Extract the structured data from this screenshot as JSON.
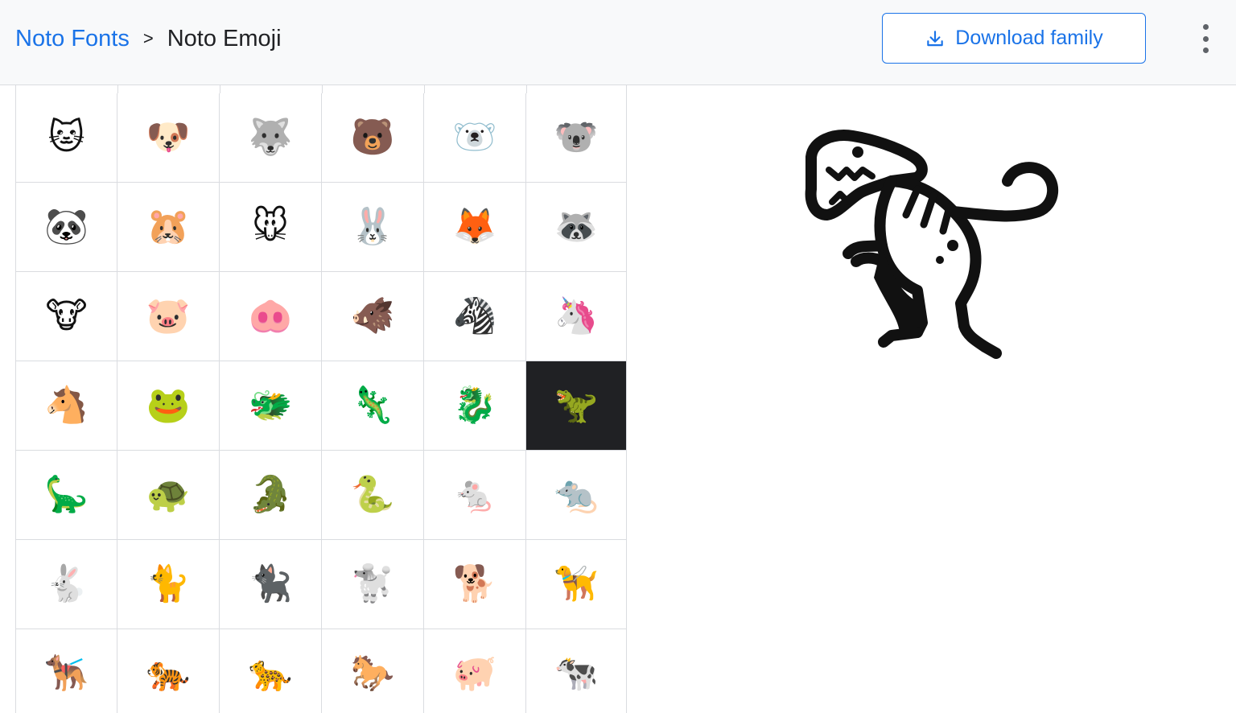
{
  "breadcrumb": {
    "root": "Noto Fonts",
    "separator": ">",
    "current": "Noto Emoji"
  },
  "toolbar": {
    "download_label": "Download family",
    "download_icon": "download-icon",
    "menu_icon": "more-vert-icon"
  },
  "colors": {
    "accent": "#1a73e8",
    "selected_bg": "#202124",
    "grid_line": "#dadce0",
    "header_bg": "#f8f9fa"
  },
  "emoji_grid": {
    "selected_index": 23,
    "cells": [
      {
        "glyph": "🐱",
        "name": "cat-face"
      },
      {
        "glyph": "🐶",
        "name": "dog-face"
      },
      {
        "glyph": "🐺",
        "name": "wolf"
      },
      {
        "glyph": "🐻",
        "name": "bear"
      },
      {
        "glyph": "🐻‍❄️",
        "name": "polar-bear"
      },
      {
        "glyph": "🐨",
        "name": "koala"
      },
      {
        "glyph": "🐼",
        "name": "panda"
      },
      {
        "glyph": "🐹",
        "name": "hamster"
      },
      {
        "glyph": "🐭",
        "name": "mouse-face"
      },
      {
        "glyph": "🐰",
        "name": "rabbit-face"
      },
      {
        "glyph": "🦊",
        "name": "fox"
      },
      {
        "glyph": "🦝",
        "name": "raccoon"
      },
      {
        "glyph": "🐮",
        "name": "cow-face"
      },
      {
        "glyph": "🐷",
        "name": "pig-face"
      },
      {
        "glyph": "🐽",
        "name": "pig-nose"
      },
      {
        "glyph": "🐗",
        "name": "boar"
      },
      {
        "glyph": "🦓",
        "name": "zebra"
      },
      {
        "glyph": "🦄",
        "name": "unicorn"
      },
      {
        "glyph": "🐴",
        "name": "horse-face"
      },
      {
        "glyph": "🐸",
        "name": "frog"
      },
      {
        "glyph": "🐲",
        "name": "dragon-face"
      },
      {
        "glyph": "🦎",
        "name": "lizard"
      },
      {
        "glyph": "🐉",
        "name": "dragon"
      },
      {
        "glyph": "🦖",
        "name": "t-rex"
      },
      {
        "glyph": "🦕",
        "name": "sauropod"
      },
      {
        "glyph": "🐢",
        "name": "turtle"
      },
      {
        "glyph": "🐊",
        "name": "crocodile"
      },
      {
        "glyph": "🐍",
        "name": "snake"
      },
      {
        "glyph": "🐁",
        "name": "mouse"
      },
      {
        "glyph": "🐀",
        "name": "rat"
      },
      {
        "glyph": "🐇",
        "name": "rabbit"
      },
      {
        "glyph": "🐈",
        "name": "cat"
      },
      {
        "glyph": "🐈‍⬛",
        "name": "black-cat"
      },
      {
        "glyph": "🐩",
        "name": "poodle"
      },
      {
        "glyph": "🐕",
        "name": "dog"
      },
      {
        "glyph": "🦮",
        "name": "guide-dog"
      },
      {
        "glyph": "🐕‍🦺",
        "name": "service-dog"
      },
      {
        "glyph": "🐅",
        "name": "tiger"
      },
      {
        "glyph": "🐆",
        "name": "leopard"
      },
      {
        "glyph": "🐎",
        "name": "horse"
      },
      {
        "glyph": "🐖",
        "name": "pig"
      },
      {
        "glyph": "🐄",
        "name": "cow"
      }
    ]
  },
  "preview": {
    "glyph_name": "t-rex",
    "icon": "t-rex-icon"
  }
}
